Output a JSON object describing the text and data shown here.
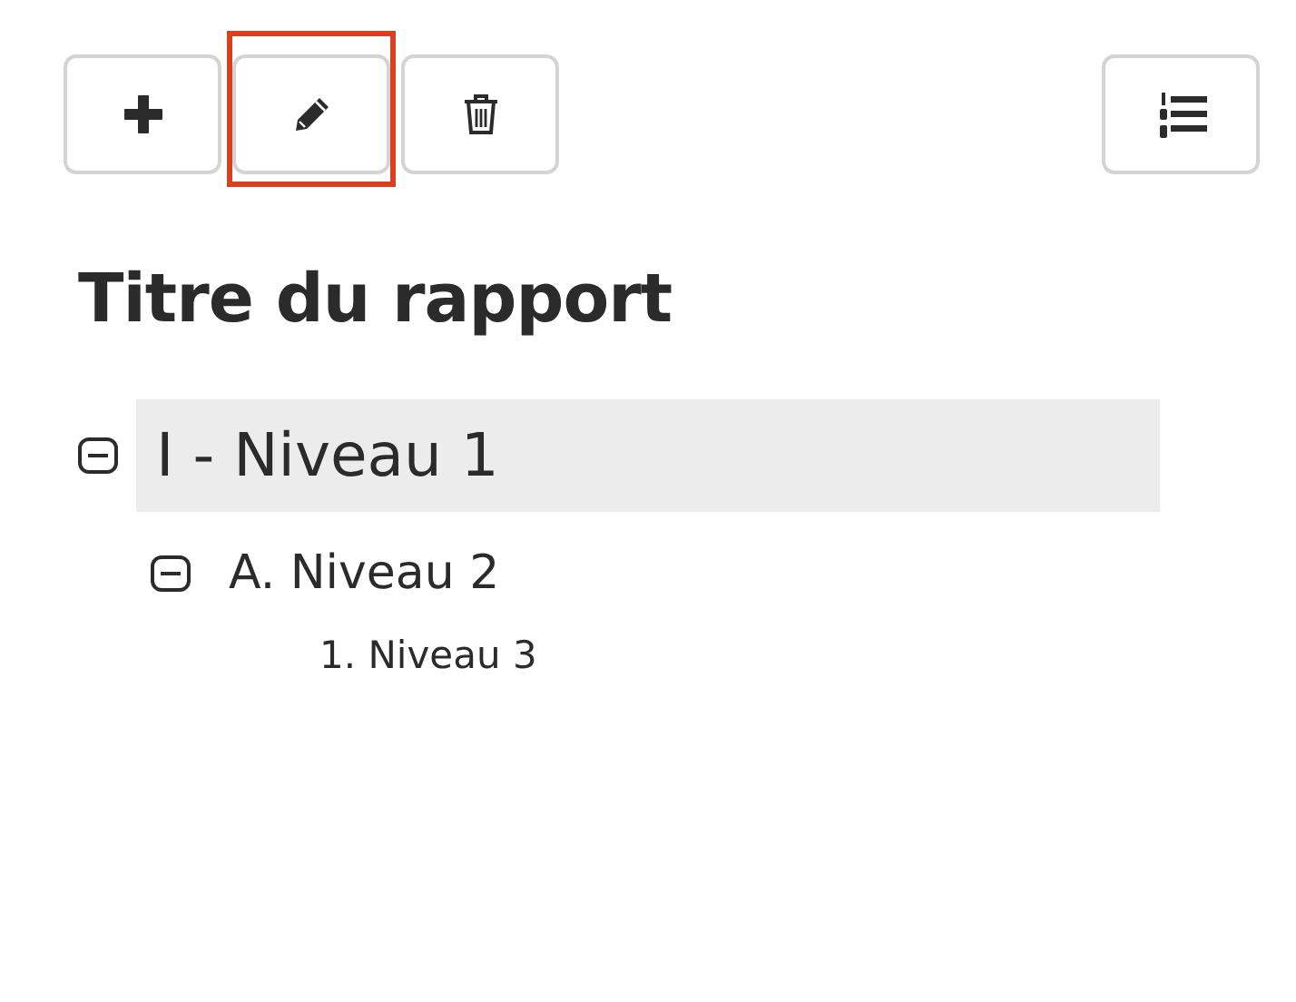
{
  "toolbar": {
    "buttons": [
      {
        "kind": "add",
        "focused": false
      },
      {
        "kind": "edit",
        "focused": true
      },
      {
        "kind": "delete",
        "focused": false
      }
    ],
    "right_button": {
      "kind": "numbered-list"
    }
  },
  "title": "Titre du rapport",
  "tree": [
    {
      "label": "I - Niveau 1",
      "selected": true,
      "expanded": true,
      "children": [
        {
          "label": "A. Niveau 2",
          "selected": false,
          "expanded": true,
          "children": [
            {
              "label": "1. Niveau 3",
              "selected": false
            }
          ]
        }
      ]
    }
  ]
}
